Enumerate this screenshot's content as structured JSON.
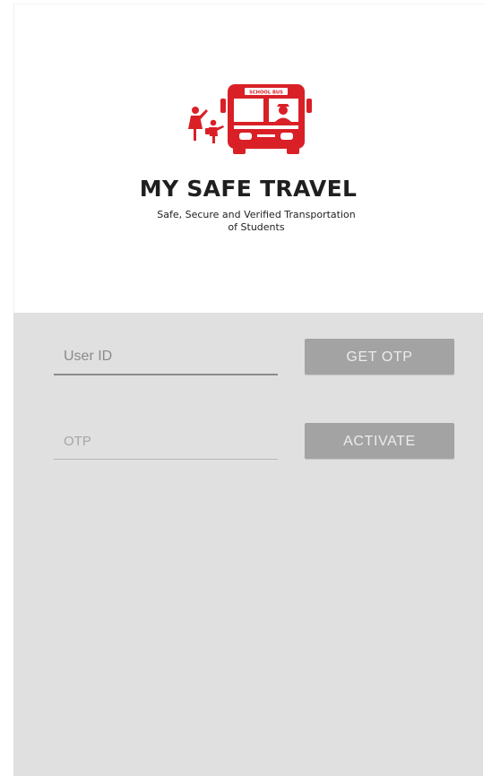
{
  "brand": {
    "title": "MY SAFE TRAVEL",
    "tagline_line1": "Safe, Secure and Verified Transportation",
    "tagline_line2": "of Students",
    "logo_bus_sign": "SCHOOL BUS",
    "accent_color": "#d92027"
  },
  "form": {
    "userid_placeholder": "User ID",
    "get_otp_label": "GET OTP",
    "otp_placeholder": "OTP",
    "activate_label": "ACTIVATE"
  },
  "colors": {
    "form_background": "#e0e0e0",
    "button_background": "#a3a3a3",
    "button_text": "#ececec"
  }
}
